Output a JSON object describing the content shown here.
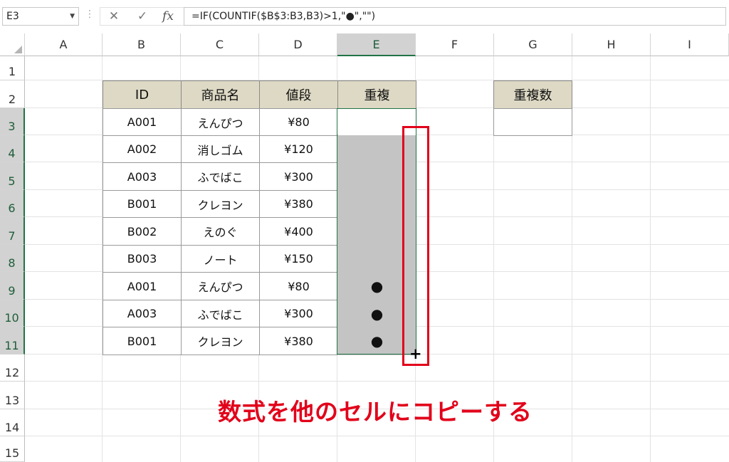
{
  "formula_bar": {
    "name_box": "E3",
    "cancel_icon": "✕",
    "enter_icon": "✓",
    "fx_label": "fx",
    "formula": "=IF(COUNTIF($B$3:B3,B3)>1,\"●\",\"\")"
  },
  "columns": [
    "A",
    "B",
    "C",
    "D",
    "E",
    "F",
    "G",
    "H",
    "I"
  ],
  "selected_column": "E",
  "rows": [
    "1",
    "2",
    "3",
    "4",
    "5",
    "6",
    "7",
    "8",
    "9",
    "10",
    "11",
    "12",
    "13",
    "14",
    "15"
  ],
  "selected_rows": [
    "3",
    "4",
    "5",
    "6",
    "7",
    "8",
    "9",
    "10",
    "11"
  ],
  "table": {
    "headers": [
      "ID",
      "商品名",
      "値段",
      "重複"
    ],
    "rows": [
      {
        "id": "A001",
        "name": "えんぴつ",
        "price": "¥80",
        "dup": ""
      },
      {
        "id": "A002",
        "name": "消しゴム",
        "price": "¥120",
        "dup": ""
      },
      {
        "id": "A003",
        "name": "ふでばこ",
        "price": "¥300",
        "dup": ""
      },
      {
        "id": "B001",
        "name": "クレヨン",
        "price": "¥380",
        "dup": ""
      },
      {
        "id": "B002",
        "name": "えのぐ",
        "price": "¥400",
        "dup": ""
      },
      {
        "id": "B003",
        "name": "ノート",
        "price": "¥150",
        "dup": ""
      },
      {
        "id": "A001",
        "name": "えんぴつ",
        "price": "¥80",
        "dup": "●"
      },
      {
        "id": "A003",
        "name": "ふでばこ",
        "price": "¥300",
        "dup": "●"
      },
      {
        "id": "B001",
        "name": "クレヨン",
        "price": "¥380",
        "dup": "●"
      }
    ]
  },
  "count_box": {
    "header": "重複数",
    "value": ""
  },
  "annotation": "数式を他のセルにコピーする",
  "colors": {
    "header_fill": "#ddd9c4",
    "selection_fill": "#c4c4c4",
    "excel_green": "#217346",
    "annotation_red": "#e2001a"
  }
}
